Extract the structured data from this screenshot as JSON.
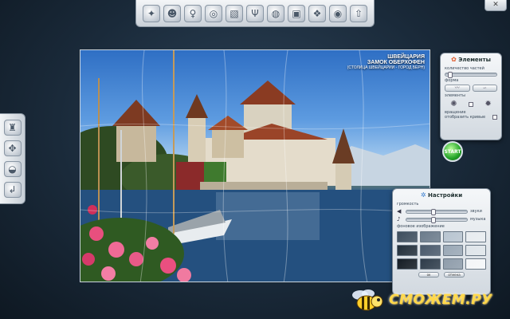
{
  "toolbar": {
    "top_icons": [
      "puzzle-pieces-icon",
      "group-icon",
      "lamp-icon",
      "wheel-icon",
      "picture-icon",
      "fork-icon",
      "globe-icon",
      "shirt-icon",
      "gift-icon",
      "camera-icon",
      "up-arrow-icon"
    ],
    "left_icons": [
      "mixer-icon",
      "pieces-icon",
      "bowl-icon",
      "exit-arrow-icon"
    ]
  },
  "window": {
    "close_label": "✕"
  },
  "puzzle": {
    "caption_line1": "ШВЕЙЦАРИЯ",
    "caption_line2": "ЗАМОК ОБЕРХОФЕН",
    "caption_line3": "(СТОЛИЦА ШВЕЙЦАРИИ - ГОРОД БЕРН)"
  },
  "elements_panel": {
    "title": "Элементы",
    "pieces_label": "количество частей",
    "pieces_level": 0.1,
    "shape_label": "форма",
    "elements_label": "элементы",
    "rotation_label": "вращение",
    "show_edges_label": "отобразить кривые",
    "start_label": "START"
  },
  "settings_panel": {
    "title": "Настройки",
    "volume_label": "громкость",
    "sound_label": "звуки",
    "sound_level": 0.45,
    "music_label": "музыка",
    "music_level": 0.45,
    "background_label": "фоновое изображение",
    "backgrounds": [
      "#3e4e5e",
      "#6c7c8c",
      "#b8c4d0",
      "#e8ecf0",
      "#23303c",
      "#4a5a6c",
      "#9aa8b6",
      "#dfe5ea",
      "#141c24",
      "#2e3c4a",
      "#8f9dab",
      "#f4f6f8"
    ],
    "ok_label": "ок",
    "cancel_label": "отмена"
  },
  "watermark": {
    "text": "СМОЖЕМ.РУ"
  }
}
